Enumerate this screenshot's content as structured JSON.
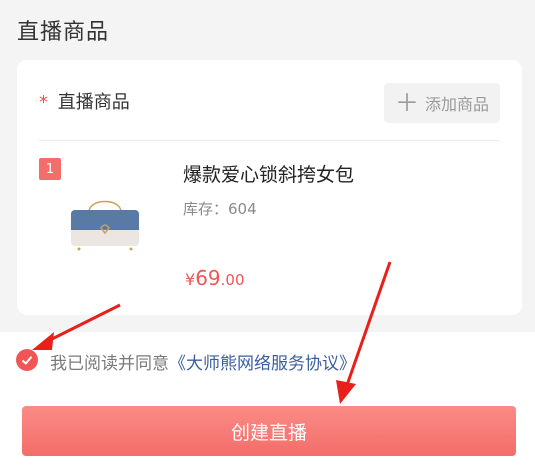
{
  "section": {
    "title": "直播商品"
  },
  "card": {
    "required_mark": "*",
    "header": "直播商品",
    "add_button": "添加商品"
  },
  "product": {
    "index": "1",
    "name": "爆款爱心锁斜挎女包",
    "stock_label": "库存：",
    "stock_value": "604",
    "price_currency": "¥",
    "price_int": "69",
    "price_dec": ".00"
  },
  "agreement": {
    "checked": true,
    "text": "我已阅读并同意",
    "link": "《大师熊网络服务协议》"
  },
  "actions": {
    "create_button": "创建直播"
  },
  "colors": {
    "accent": "#f05656",
    "link": "#3b5f9e",
    "arrow": "#e8201c"
  }
}
